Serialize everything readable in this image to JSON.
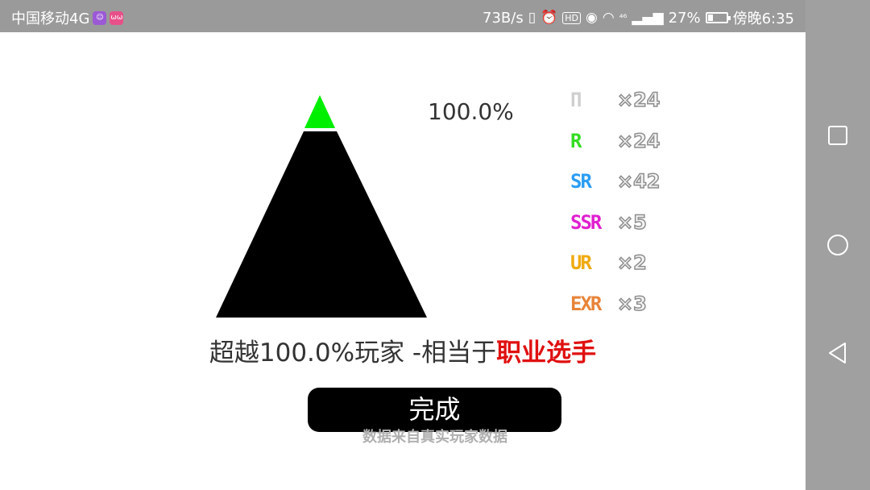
{
  "status_bar": {
    "carrier": "中国移动4G",
    "app_icon_1": "app-notification-icon",
    "app_icon_2_text": "ωω",
    "net_speed": "73B/s",
    "network": "⁴⁶",
    "battery_percent": "27%",
    "battery_level": 0.27,
    "time": "傍晚6:35"
  },
  "main": {
    "percent": "100.0%",
    "pyramid_colors": {
      "tip": "#00ee00",
      "body": "#000000"
    },
    "rarities": [
      {
        "name": "Π",
        "count": "×24",
        "color": "#cfcfcf"
      },
      {
        "name": "R",
        "count": "×24",
        "color": "#33dd22"
      },
      {
        "name": "SR",
        "count": "×42",
        "color": "#2a9df4"
      },
      {
        "name": "SSR",
        "count": "×5",
        "color": "#e020d0"
      },
      {
        "name": "UR",
        "count": "×2",
        "color": "#f0aa10"
      },
      {
        "name": "EXR",
        "count": "×3",
        "color": "#e8843a"
      }
    ],
    "summary_prefix": "超越100.0%玩家 -相当于",
    "summary_rank": "职业选手",
    "done_label": "完成",
    "footnote": "数据来自真实玩家数据"
  },
  "nav_bar": {
    "recent_icon": "square-icon",
    "home_icon": "circle-icon",
    "back_icon": "triangle-back-icon"
  }
}
